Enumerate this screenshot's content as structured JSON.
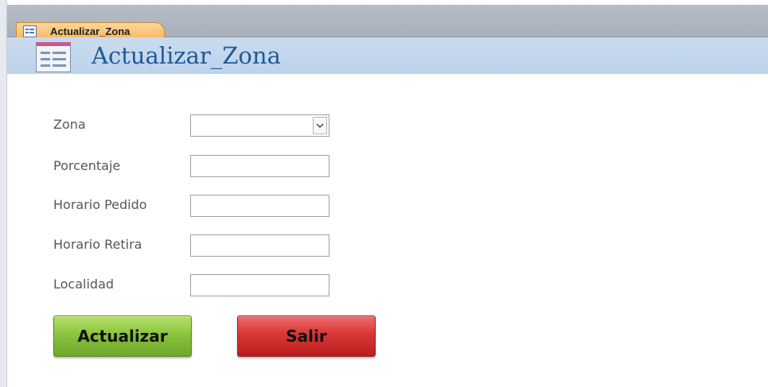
{
  "tab": {
    "label": "Actualizar_Zona",
    "icon": "form-icon"
  },
  "header": {
    "title": "Actualizar_Zona",
    "icon": "form-icon"
  },
  "fields": [
    {
      "label": "Zona",
      "value": "",
      "type": "combo"
    },
    {
      "label": "Porcentaje",
      "value": ""
    },
    {
      "label": "Horario Pedido",
      "value": ""
    },
    {
      "label": "Horario Retira",
      "value": ""
    },
    {
      "label": "Localidad",
      "value": ""
    }
  ],
  "buttons": {
    "actualizar": "Actualizar",
    "salir": "Salir"
  },
  "colors": {
    "header_bg": "#c9dbef",
    "title": "#1f5a94",
    "tab_bg": "#f4b45a",
    "btn_green": "#8bc43e",
    "btn_red": "#d93636"
  }
}
